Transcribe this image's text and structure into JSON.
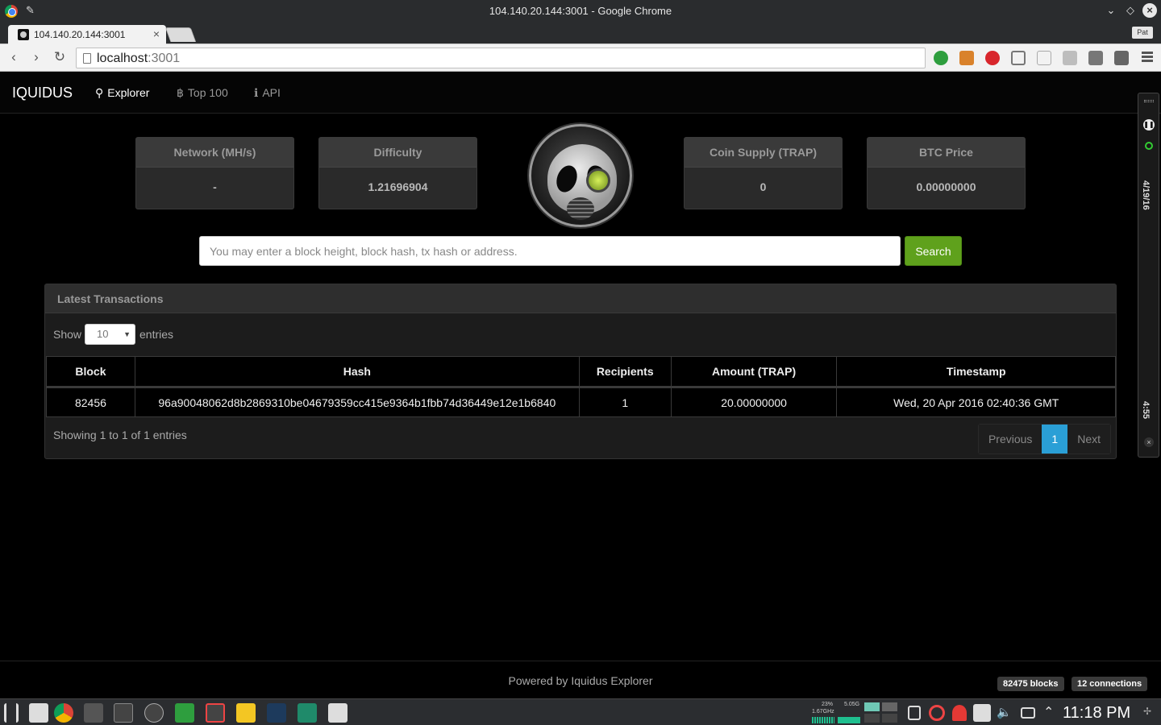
{
  "window": {
    "title": "104.140.20.144:3001 - Google Chrome",
    "tab_label": "104.140.20.144:3001",
    "tab_close": "×",
    "profile": "Pat",
    "url_host": "localhost",
    "url_port": ":3001"
  },
  "nav": {
    "brand": "IQUIDUS",
    "items": [
      {
        "label": "Explorer",
        "icon": "search-icon",
        "active": true
      },
      {
        "label": "Top 100",
        "icon": "bitcoin-icon",
        "active": false
      },
      {
        "label": "API",
        "icon": "info-icon",
        "active": false
      }
    ]
  },
  "stats": {
    "network": {
      "label": "Network (MH/s)",
      "value": "-"
    },
    "difficulty": {
      "label": "Difficulty",
      "value": "1.21696904"
    },
    "supply": {
      "label": "Coin Supply (TRAP)",
      "value": "0"
    },
    "btc_price": {
      "label": "BTC Price",
      "value": "0.00000000"
    }
  },
  "search": {
    "placeholder": "You may enter a block height, block hash, tx hash or address.",
    "button": "Search"
  },
  "transactions": {
    "title": "Latest Transactions",
    "show_label": "Show",
    "entries_label": "entries",
    "page_length": "10",
    "columns": [
      "Block",
      "Hash",
      "Recipients",
      "Amount (TRAP)",
      "Timestamp"
    ],
    "rows": [
      {
        "block": "82456",
        "hash": "96a90048062d8b2869310be04679359cc415e9364b1fbb74d36449e12e1b6840",
        "recipients": "1",
        "amount": "20.00000000",
        "timestamp": "Wed, 20 Apr 2016 02:40:36 GMT"
      }
    ],
    "info": "Showing 1 to 1 of 1 entries",
    "pager": {
      "previous": "Previous",
      "current": "1",
      "next": "Next"
    }
  },
  "footer": {
    "powered": "Powered by Iquidus Explorer",
    "blocks": "82475 blocks",
    "connections": "12 connections"
  },
  "side_widget": {
    "date": "4/19/16",
    "time": "4:55"
  },
  "taskbar": {
    "cpu_pct": "23%",
    "cpu_freq": "1.67GHz",
    "mem": "5.05G",
    "clock": "11:18 PM"
  },
  "colors": {
    "accent_green": "#5fa11c",
    "pager_active": "#2a9fd6",
    "background": "#000000"
  }
}
